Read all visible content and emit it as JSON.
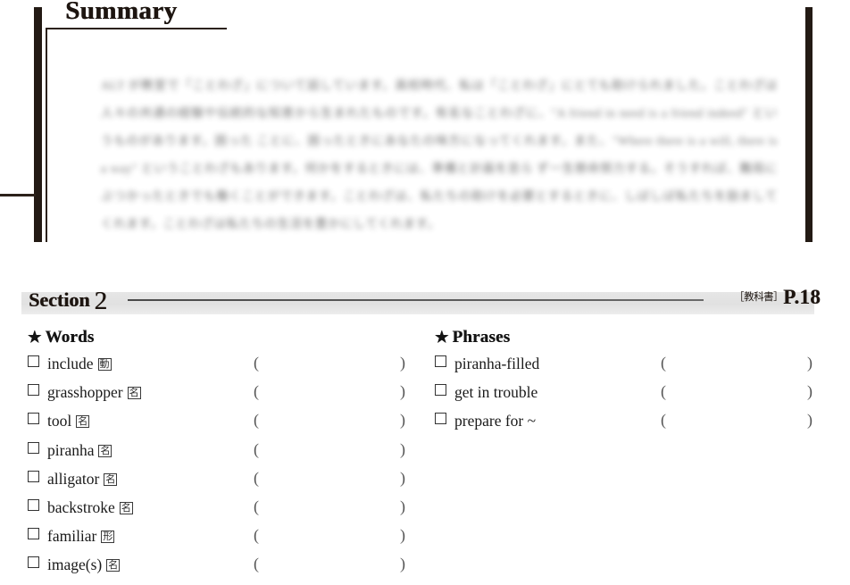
{
  "summary": {
    "title": "Summary",
    "body_text": "ALT が教室で「ことわざ」について話しています。高校時代、私は「ことわざ」にとても助けられました。ことわざは人々の共通の経験や伝統的な知恵から生まれたものです。有名なことわざに、\"A friend in need is a friend indeed\" というものがあります。困った ことに、困ったときにあなたの味方になってくれます。また、\"Where there is a will, there is a way\" ということわざもあります。何かをするときには、準備と計画を怠ら ず一生懸命努力する。そうすれば、難局にぶつかったときでも働くことができます。ことわざは、私たちの助けを必要とするときに、しばしば私たちを励ましてくれます。ことわざは私たちの生活を豊かにしてくれます。"
  },
  "section": {
    "label": "Section",
    "number": "2",
    "textbook_tag": "［教科書］",
    "page_ref": "P.18"
  },
  "words": {
    "heading": "Words",
    "star": "★",
    "paren_open": "(",
    "paren_close": ")",
    "items": [
      {
        "checkbox": "☐",
        "term": "include",
        "pos": "動"
      },
      {
        "checkbox": "☐",
        "term": "grasshopper",
        "pos": "名"
      },
      {
        "checkbox": "☐",
        "term": "tool",
        "pos": "名"
      },
      {
        "checkbox": "☐",
        "term": "piranha",
        "pos": "名"
      },
      {
        "checkbox": "☐",
        "term": "alligator",
        "pos": "名"
      },
      {
        "checkbox": "☐",
        "term": "backstroke",
        "pos": "名"
      },
      {
        "checkbox": "☐",
        "term": "familiar",
        "pos": "形"
      },
      {
        "checkbox": "☐",
        "term": "image(s)",
        "pos": "名"
      }
    ]
  },
  "phrases": {
    "heading": "Phrases",
    "star": "★",
    "paren_open": "(",
    "paren_close": ")",
    "items": [
      {
        "checkbox": "☐",
        "term": "piranha-filled",
        "pos": ""
      },
      {
        "checkbox": "☐",
        "term": "get in trouble",
        "pos": ""
      },
      {
        "checkbox": "☐",
        "term": "prepare for ~",
        "pos": ""
      }
    ]
  },
  "colors": {
    "ink": "#1d1510",
    "rule": "#4a4a4a",
    "band": "#e3e3e3",
    "paren": "#555555"
  }
}
